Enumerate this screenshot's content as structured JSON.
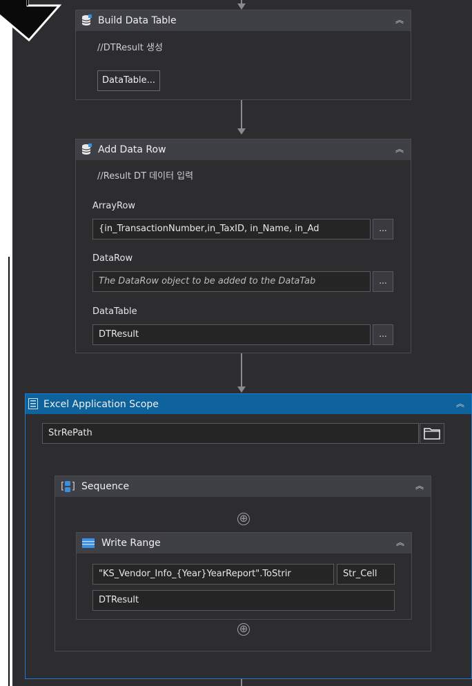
{
  "build_data_table": {
    "title": "Build Data Table",
    "annotation": "//DTResult 생성",
    "button_label": "DataTable..."
  },
  "add_data_row": {
    "title": "Add Data Row",
    "annotation": "//Result DT 데이터 입력",
    "array_row_label": "ArrayRow",
    "array_row_value": "{in_TransactionNumber,in_TaxID, in_Name, in_Ad",
    "data_row_label": "DataRow",
    "data_row_placeholder": "The DataRow object to be added to the DataTab",
    "data_table_label": "DataTable",
    "data_table_value": "DTResult",
    "ellipsis": "..."
  },
  "excel_scope": {
    "title": "Excel Application Scope",
    "path_value": "StrRePath"
  },
  "sequence": {
    "title": "Sequence",
    "icon_bracket_open": "[",
    "icon_bracket_close": "]",
    "add_glyph": "⊕"
  },
  "write_range": {
    "title": "Write Range",
    "sheet_value": "\"KS_Vendor_Info_{Year}YearReport\".ToStrir",
    "cell_value": "Str_Cell",
    "data_table_value": "DTResult"
  },
  "collapse_glyph": "︽",
  "colors": {
    "canvas_bg": "#2d2d30",
    "header_bg": "#3f3f46",
    "scope_header": "#0e639c",
    "scope_border": "#1e7ad6",
    "connector": "#8a8a8a"
  }
}
